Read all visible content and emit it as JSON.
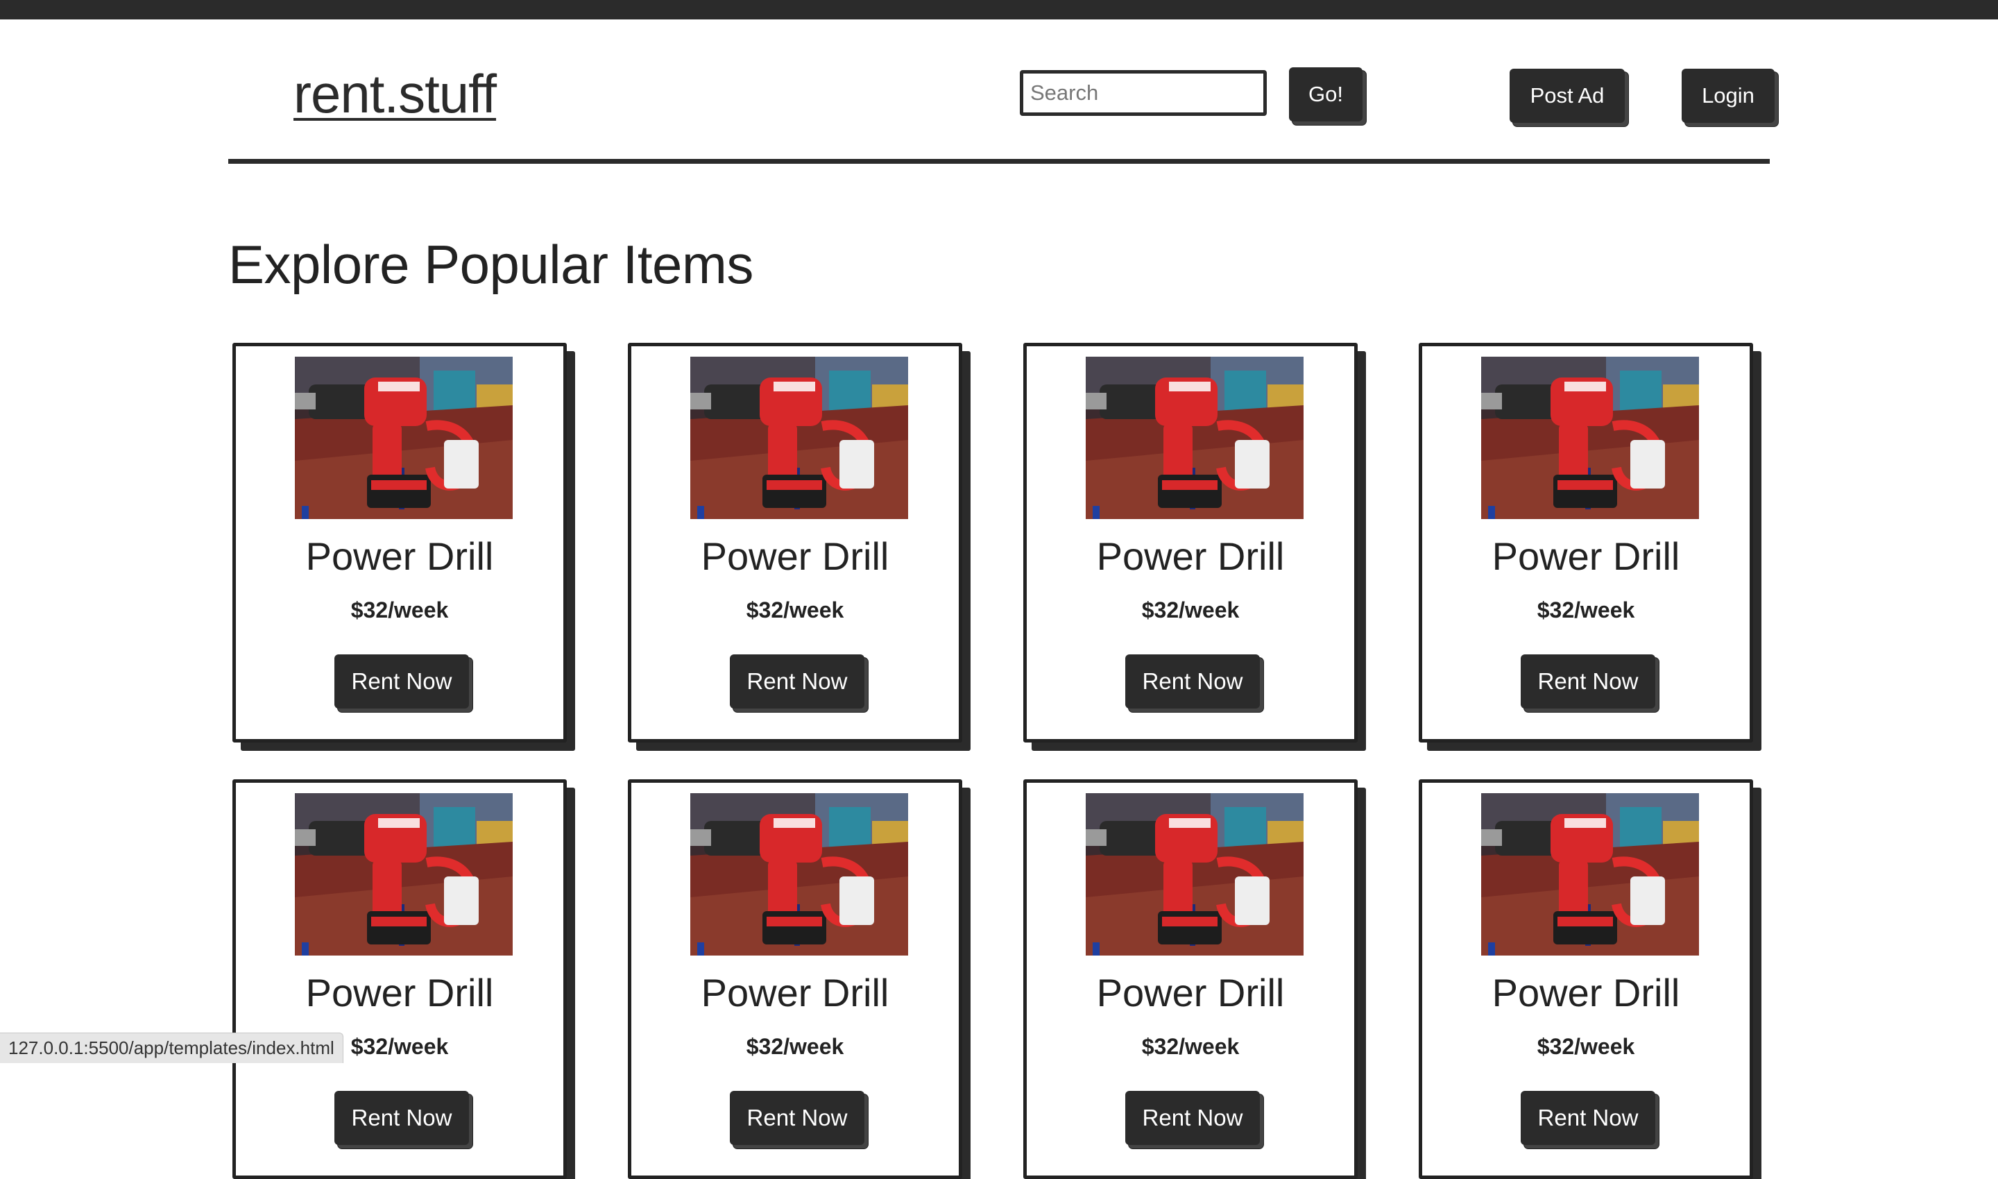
{
  "brand": {
    "logo": "rent.stuff"
  },
  "header": {
    "search_placeholder": "Search",
    "go_label": "Go!",
    "post_ad_label": "Post Ad",
    "login_label": "Login"
  },
  "main": {
    "heading": "Explore Popular Items",
    "items": [
      {
        "title": "Power Drill",
        "price": "$32/week",
        "button": "Rent Now",
        "image": "power-drill-photo"
      },
      {
        "title": "Power Drill",
        "price": "$32/week",
        "button": "Rent Now",
        "image": "power-drill-photo"
      },
      {
        "title": "Power Drill",
        "price": "$32/week",
        "button": "Rent Now",
        "image": "power-drill-photo"
      },
      {
        "title": "Power Drill",
        "price": "$32/week",
        "button": "Rent Now",
        "image": "power-drill-photo"
      },
      {
        "title": "Power Drill",
        "price": "$32/week",
        "button": "Rent Now",
        "image": "power-drill-photo"
      },
      {
        "title": "Power Drill",
        "price": "$32/week",
        "button": "Rent Now",
        "image": "power-drill-photo"
      },
      {
        "title": "Power Drill",
        "price": "$32/week",
        "button": "Rent Now",
        "image": "power-drill-photo"
      },
      {
        "title": "Power Drill",
        "price": "$32/week",
        "button": "Rent Now",
        "image": "power-drill-photo"
      }
    ]
  },
  "status_url": "127.0.0.1:5500/app/templates/index.html",
  "colors": {
    "primary": "#2b2b2b",
    "background": "#ffffff",
    "text": "#222222"
  }
}
